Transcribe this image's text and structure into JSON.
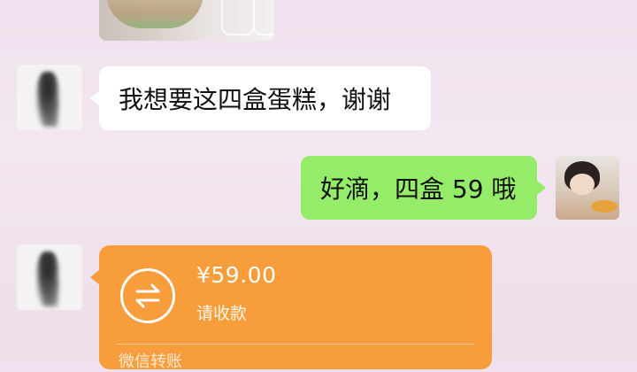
{
  "chat": {
    "messages": [
      {
        "sender": "other",
        "type": "image"
      },
      {
        "sender": "other",
        "type": "text",
        "text": "我想要这四盒蛋糕，谢谢"
      },
      {
        "sender": "self",
        "type": "text",
        "text": "好滴，四盒 59 哦"
      },
      {
        "sender": "other",
        "type": "transfer",
        "amount": "¥59.00",
        "status": "请收款",
        "footer": "微信转账"
      }
    ]
  },
  "colors": {
    "background": "#f0e3ee",
    "incoming_bubble": "#ffffff",
    "outgoing_bubble": "#95ec69",
    "transfer_card": "#f89d3c"
  },
  "icons": {
    "transfer": "transfer-arrows-icon"
  }
}
